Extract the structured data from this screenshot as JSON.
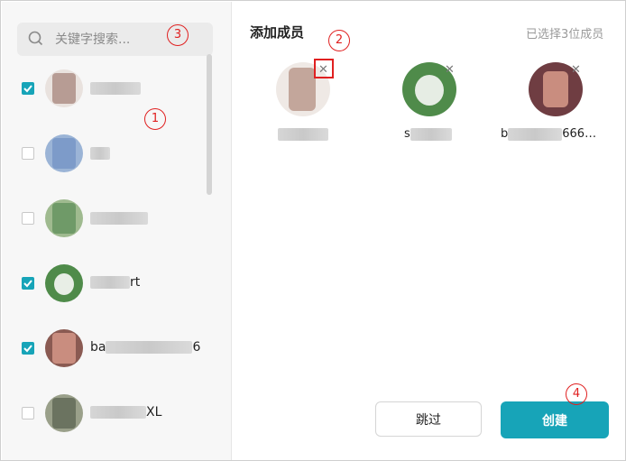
{
  "search": {
    "placeholder": "关键字搜索..."
  },
  "members": [
    {
      "name_prefix": "",
      "name_suffix": "",
      "checked": true
    },
    {
      "name_prefix": "",
      "name_suffix": "",
      "checked": false
    },
    {
      "name_prefix": "",
      "name_suffix": "",
      "checked": false
    },
    {
      "name_prefix": "",
      "name_suffix": "rt",
      "checked": true
    },
    {
      "name_prefix": "ba",
      "name_suffix": "6",
      "checked": true
    },
    {
      "name_prefix": "",
      "name_suffix": "XL",
      "checked": false
    }
  ],
  "panel": {
    "title": "添加成员",
    "selected_count": "已选择3位成员"
  },
  "selected": [
    {
      "name_prefix": "",
      "name_suffix": "",
      "remove": "✕"
    },
    {
      "name_prefix": "s",
      "name_suffix": "",
      "remove": "✕"
    },
    {
      "name_prefix": "b",
      "name_suffix": "666…",
      "remove": "✕"
    }
  ],
  "buttons": {
    "skip": "跳过",
    "create": "创建"
  },
  "callouts": [
    "1",
    "2",
    "3",
    "4"
  ],
  "colors": {
    "accent": "#17a4b8",
    "annotation": "#e02020"
  }
}
